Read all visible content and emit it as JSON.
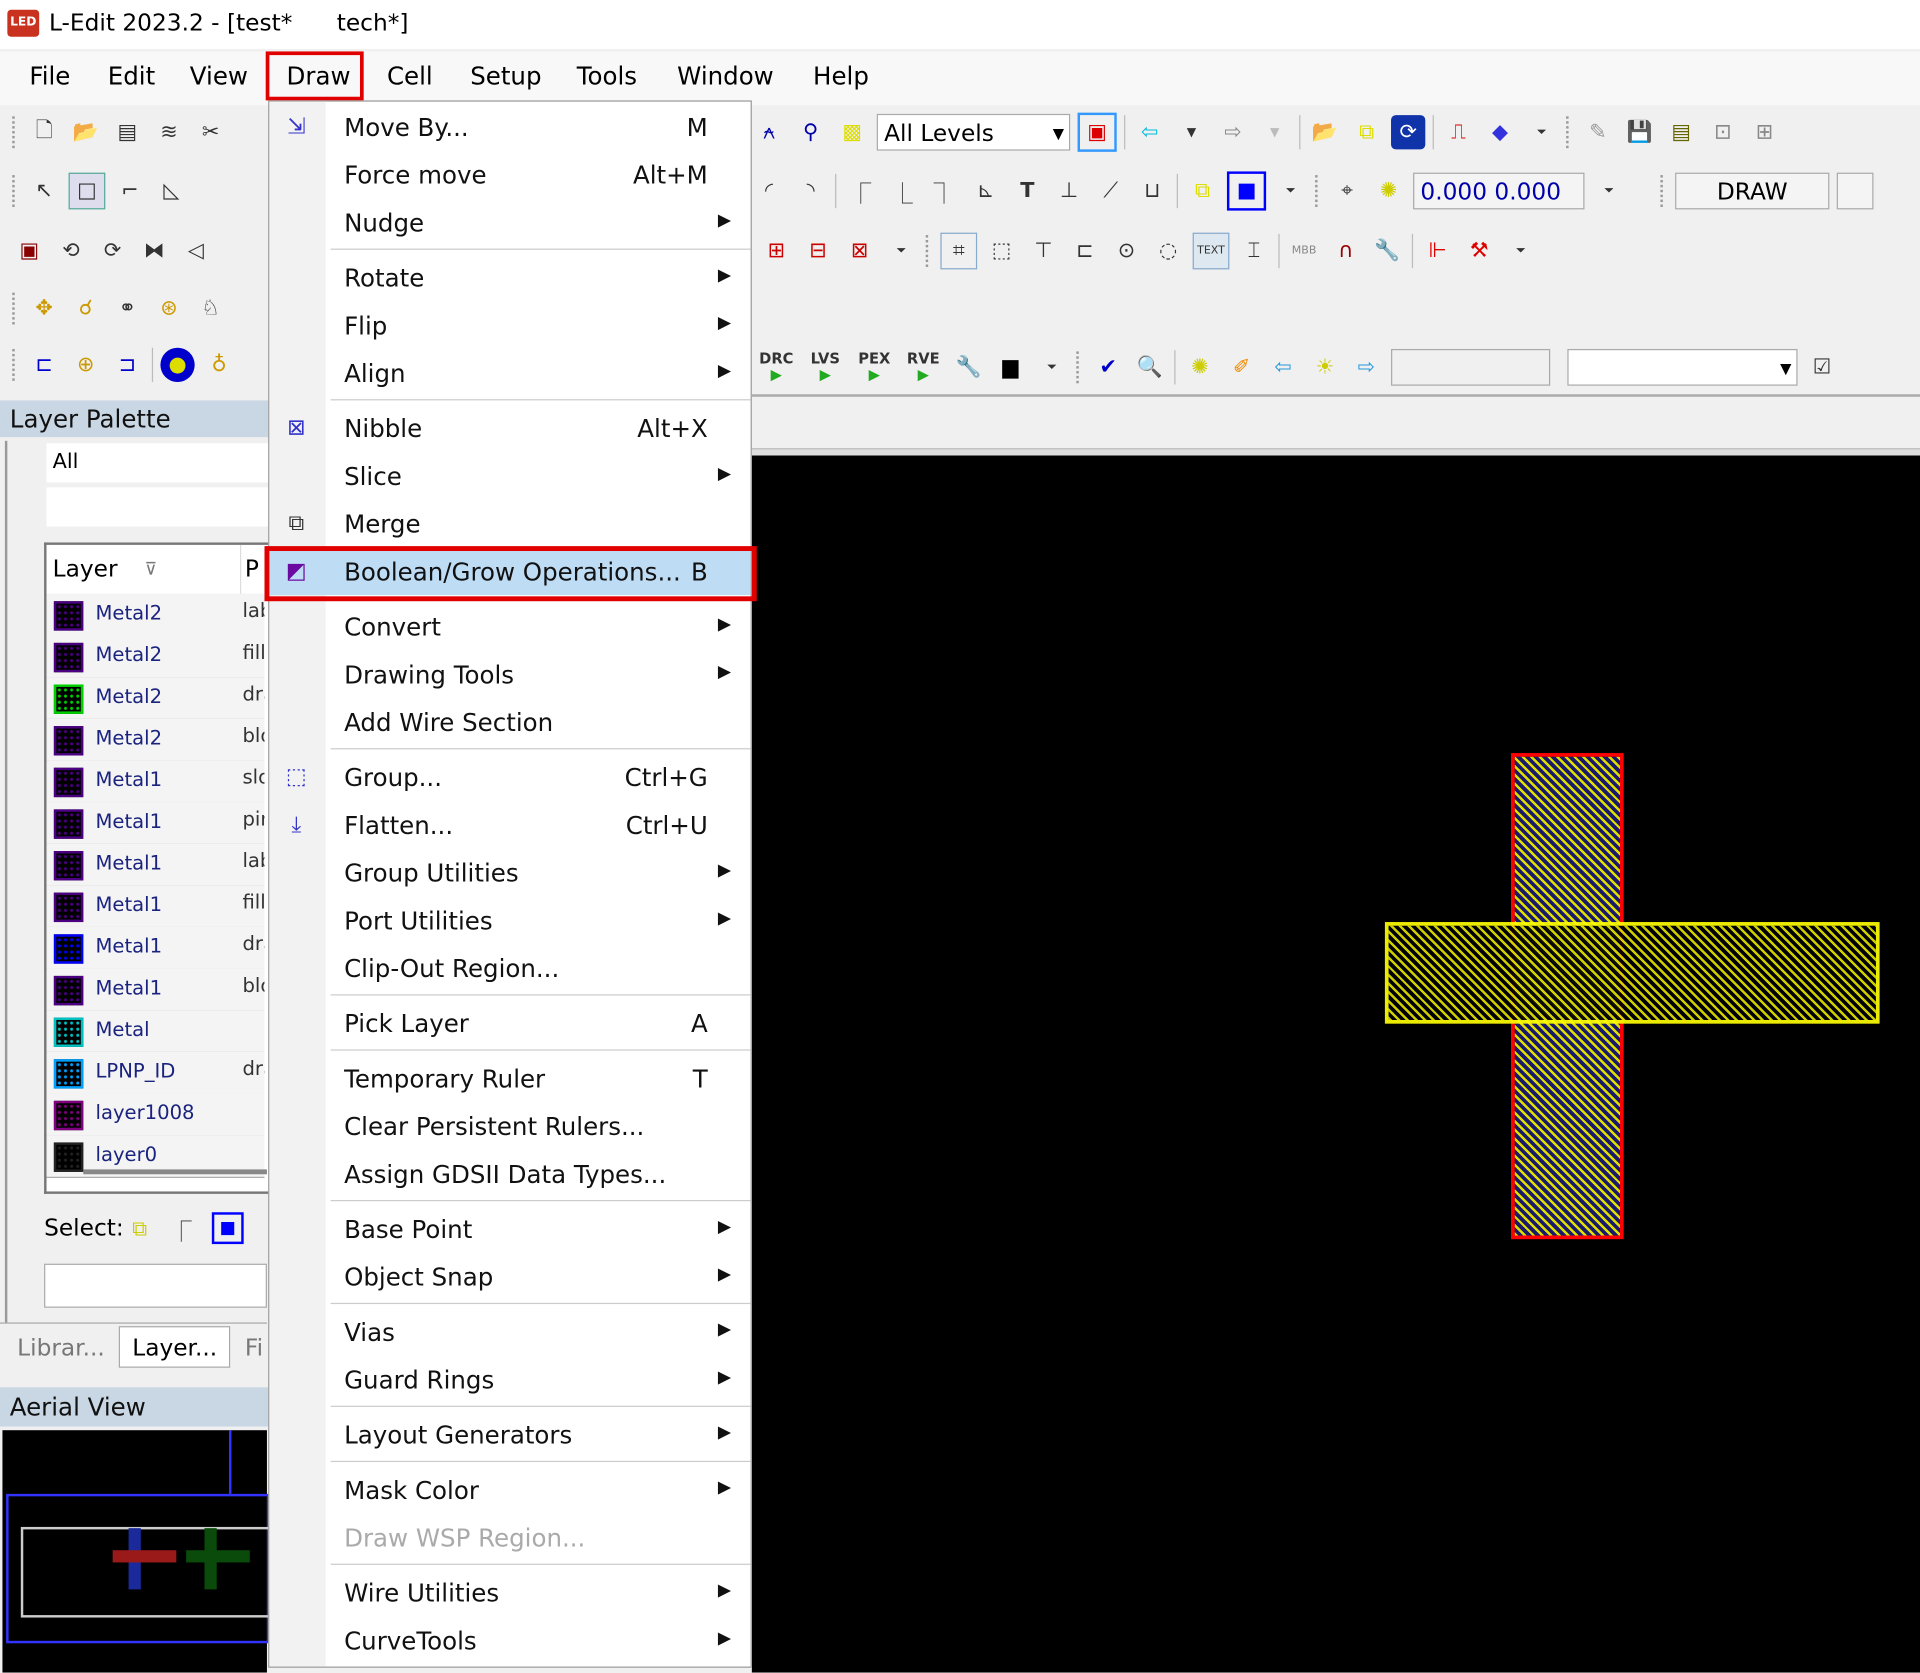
{
  "window": {
    "app_icon": "LED",
    "title": "L-Edit 2023.2 - [test*      tech*]"
  },
  "menubar": [
    "File",
    "Edit",
    "View",
    "Draw",
    "Cell",
    "Setup",
    "Tools",
    "Window",
    "Help"
  ],
  "active_menu": "Draw",
  "toolbar": {
    "levels_dropdown": "All Levels",
    "coordinates": "0.000 0.000",
    "mode": "DRAW",
    "verification": [
      "DRC",
      "LVS",
      "PEX",
      "RVE"
    ],
    "text_tool": "T",
    "text_button": "TEXT",
    "mbb_button": "MBB",
    "search_field": "",
    "search_dropdown": ""
  },
  "layer_palette": {
    "title": "Layer Palette",
    "filter": "All",
    "filter2": "",
    "columns": [
      "Layer",
      "P"
    ],
    "layers": [
      {
        "name": "Metal2",
        "purpose": "lab",
        "color": "#4b0082"
      },
      {
        "name": "Metal2",
        "purpose": "fill",
        "color": "#4b0082"
      },
      {
        "name": "Metal2",
        "purpose": "dra",
        "color": "#00d000"
      },
      {
        "name": "Metal2",
        "purpose": "blo",
        "color": "#4b0082"
      },
      {
        "name": "Metal1",
        "purpose": "slo",
        "color": "#4b0082"
      },
      {
        "name": "Metal1",
        "purpose": "pir",
        "color": "#4b0082"
      },
      {
        "name": "Metal1",
        "purpose": "lab",
        "color": "#4b0082"
      },
      {
        "name": "Metal1",
        "purpose": "fill",
        "color": "#4b0082"
      },
      {
        "name": "Metal1",
        "purpose": "dra",
        "color": "#0000ff"
      },
      {
        "name": "Metal1",
        "purpose": "blo",
        "color": "#4b0082"
      },
      {
        "name": "Metal",
        "purpose": "",
        "color": "#00c0c0"
      },
      {
        "name": "LPNP_ID",
        "purpose": "dra",
        "color": "#00a0ff"
      },
      {
        "name": "layer1008",
        "purpose": "",
        "color": "#800080"
      },
      {
        "name": "layer0",
        "purpose": "",
        "color": "#222222"
      }
    ],
    "select_label": "Select:",
    "tabs": [
      "Librar...",
      "Layer...",
      "Fi"
    ]
  },
  "aerial_view": {
    "title": "Aerial View"
  },
  "draw_menu": [
    {
      "label": "Move By...",
      "shortcut": "M",
      "icon": "move-by-icon"
    },
    {
      "label": "Force move",
      "shortcut": "Alt+M"
    },
    {
      "label": "Nudge",
      "submenu": true
    },
    {
      "sep": true
    },
    {
      "label": "Rotate",
      "submenu": true
    },
    {
      "label": "Flip",
      "submenu": true
    },
    {
      "label": "Align",
      "submenu": true
    },
    {
      "sep": true
    },
    {
      "label": "Nibble",
      "shortcut": "Alt+X",
      "icon": "nibble-icon"
    },
    {
      "label": "Slice",
      "submenu": true
    },
    {
      "label": "Merge",
      "icon": "merge-icon"
    },
    {
      "label": "Boolean/Grow Operations...",
      "shortcut": "B",
      "icon": "boolean-icon",
      "highlighted": true
    },
    {
      "sep": true
    },
    {
      "label": "Convert",
      "submenu": true
    },
    {
      "label": "Drawing Tools",
      "submenu": true
    },
    {
      "label": "Add Wire Section"
    },
    {
      "sep": true
    },
    {
      "label": "Group...",
      "shortcut": "Ctrl+G",
      "icon": "group-icon"
    },
    {
      "label": "Flatten...",
      "shortcut": "Ctrl+U",
      "icon": "flatten-icon"
    },
    {
      "label": "Group Utilities",
      "submenu": true
    },
    {
      "label": "Port Utilities",
      "submenu": true
    },
    {
      "label": "Clip-Out Region..."
    },
    {
      "sep": true
    },
    {
      "label": "Pick Layer",
      "shortcut": "A"
    },
    {
      "sep": true
    },
    {
      "label": "Temporary Ruler",
      "shortcut": "T"
    },
    {
      "label": "Clear Persistent Rulers..."
    },
    {
      "label": "Assign GDSII Data Types..."
    },
    {
      "sep": true
    },
    {
      "label": "Base Point",
      "submenu": true
    },
    {
      "label": "Object Snap",
      "submenu": true
    },
    {
      "sep": true
    },
    {
      "label": "Vias",
      "submenu": true
    },
    {
      "label": "Guard Rings",
      "submenu": true
    },
    {
      "sep": true
    },
    {
      "label": "Layout Generators",
      "submenu": true
    },
    {
      "sep": true
    },
    {
      "label": "Mask Color",
      "submenu": true
    },
    {
      "label": "Draw WSP Region...",
      "disabled": true
    },
    {
      "sep": true
    },
    {
      "label": "Wire Utilities",
      "submenu": true
    },
    {
      "label": "CurveTools",
      "submenu": true
    }
  ],
  "colors": {
    "highlight": "#bfdcf5",
    "annotation_red": "#e00000",
    "canvas": "#000000",
    "shape_yellow": "#ffff00",
    "shape_red": "#ff0000"
  }
}
